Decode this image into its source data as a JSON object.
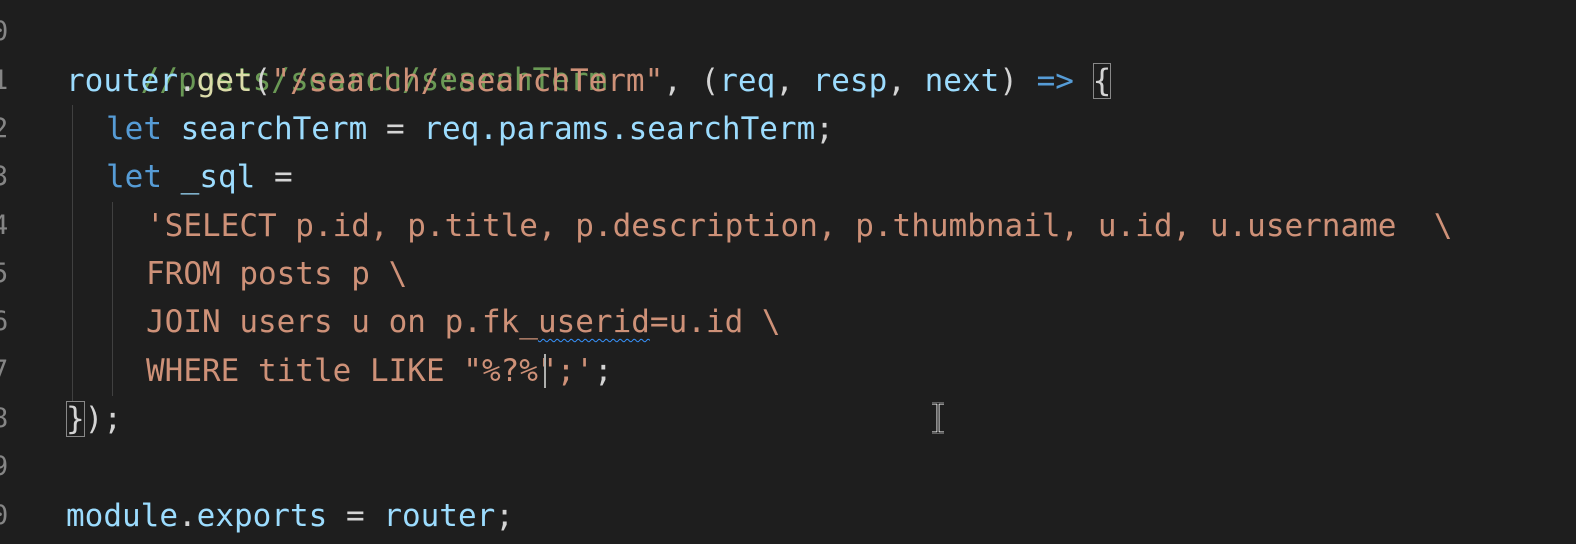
{
  "editor": {
    "line_numbers": [
      "0",
      "1",
      "2",
      "3",
      "4",
      "5",
      "6",
      "7",
      "8",
      "9",
      "0"
    ],
    "lines": {
      "l0": {
        "comment": "//posts/search/searchTerm"
      },
      "l1": {
        "obj": "router",
        "dot": ".",
        "fn": "get",
        "open_paren": "(",
        "path": "\"/search/:searchTerm\"",
        "comma": ", ",
        "args_open": "(",
        "arg1": "req",
        "sep1": ", ",
        "arg2": "resp",
        "sep2": ", ",
        "arg3": "next",
        "args_close": ")",
        "arrow": " => ",
        "brace": "{"
      },
      "l2": {
        "kw": "let",
        "name": " searchTerm",
        "eq": " = ",
        "rhs": "req.params.searchTerm",
        "semi": ";"
      },
      "l3": {
        "kw": "let",
        "name": " _sql",
        "eq": " ="
      },
      "l4": {
        "str": "'SELECT p.id, p.title, p.description, p.thumbnail, u.id, u.username  \\"
      },
      "l5": {
        "str": "FROM posts p \\"
      },
      "l6": {
        "str_a": "JOIN users u on p.fk_",
        "str_squiggle": "userid",
        "str_b": "=u.id \\"
      },
      "l7": {
        "str_a": "WHERE title LIKE \"%?",
        "str_b": "%\";'",
        "semi": ";"
      },
      "l8": {
        "brace": "}",
        "rest": ");"
      },
      "l9": {},
      "l10": {
        "obj": "module",
        "dot": ".",
        "prop": "exports",
        "eq": " = ",
        "rhs": "router",
        "semi": ";"
      }
    }
  },
  "colors": {
    "background": "#1e1e1e",
    "comment": "#6a9955",
    "keyword": "#569cd6",
    "function": "#dcdcaa",
    "variable": "#9cdcfe",
    "string": "#ce9178"
  },
  "icons": {
    "mouse_cursor": "i-beam-cursor-icon"
  }
}
